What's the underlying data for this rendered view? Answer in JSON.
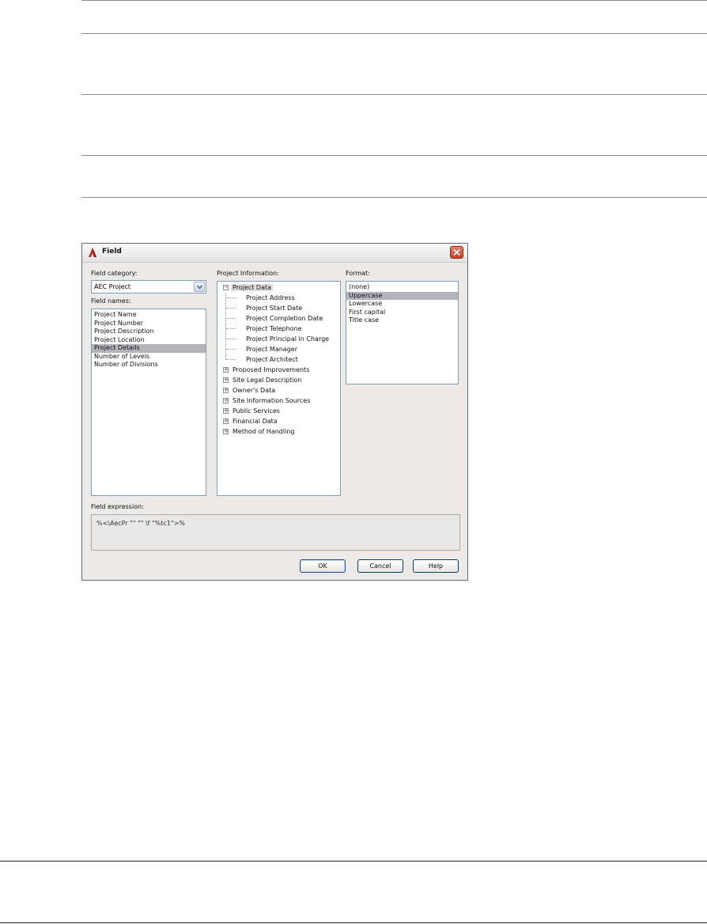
{
  "window": {
    "title": "Field"
  },
  "left": {
    "category_label": "Field category:",
    "category_value": "AEC Project",
    "names_label": "Field names:",
    "names": [
      {
        "label": "Project Name",
        "selected": false
      },
      {
        "label": "Project Number",
        "selected": false
      },
      {
        "label": "Project Description",
        "selected": false
      },
      {
        "label": "Project Location",
        "selected": false
      },
      {
        "label": "Project Details",
        "selected": true
      },
      {
        "label": "Number of Levels",
        "selected": false
      },
      {
        "label": "Number of Divisions",
        "selected": false
      }
    ]
  },
  "middle": {
    "label": "Project Information:",
    "tree": [
      {
        "label": "Project Data",
        "level": 0,
        "toggle": "minus",
        "selected": true
      },
      {
        "label": "Project Address",
        "level": 1
      },
      {
        "label": "Project Start Date",
        "level": 1
      },
      {
        "label": "Project Completion Date",
        "level": 1
      },
      {
        "label": "Project Telephone",
        "level": 1
      },
      {
        "label": "Project Principal in Charge",
        "level": 1
      },
      {
        "label": "Project Manager",
        "level": 1
      },
      {
        "label": "Project Architect",
        "level": 1
      },
      {
        "label": "Proposed Improvements",
        "level": 0,
        "toggle": "plus"
      },
      {
        "label": "Site Legal Description",
        "level": 0,
        "toggle": "plus"
      },
      {
        "label": "Owner's Data",
        "level": 0,
        "toggle": "plus"
      },
      {
        "label": "Site Information Sources",
        "level": 0,
        "toggle": "plus"
      },
      {
        "label": "Public Services",
        "level": 0,
        "toggle": "plus"
      },
      {
        "label": "Financial Data",
        "level": 0,
        "toggle": "plus"
      },
      {
        "label": "Method of Handling",
        "level": 0,
        "toggle": "plus"
      }
    ]
  },
  "right": {
    "label": "Format:",
    "formats": [
      {
        "label": "(none)",
        "selected": false
      },
      {
        "label": "Uppercase",
        "selected": true
      },
      {
        "label": "Lowercase",
        "selected": false
      },
      {
        "label": "First capital",
        "selected": false
      },
      {
        "label": "Title case",
        "selected": false
      }
    ]
  },
  "expression": {
    "label": "Field expression:",
    "value": "%<\\AecPr \"\" \"\" \\f \"%tc1\">%"
  },
  "buttons": {
    "ok": "OK",
    "cancel": "Cancel",
    "help": "Help"
  }
}
